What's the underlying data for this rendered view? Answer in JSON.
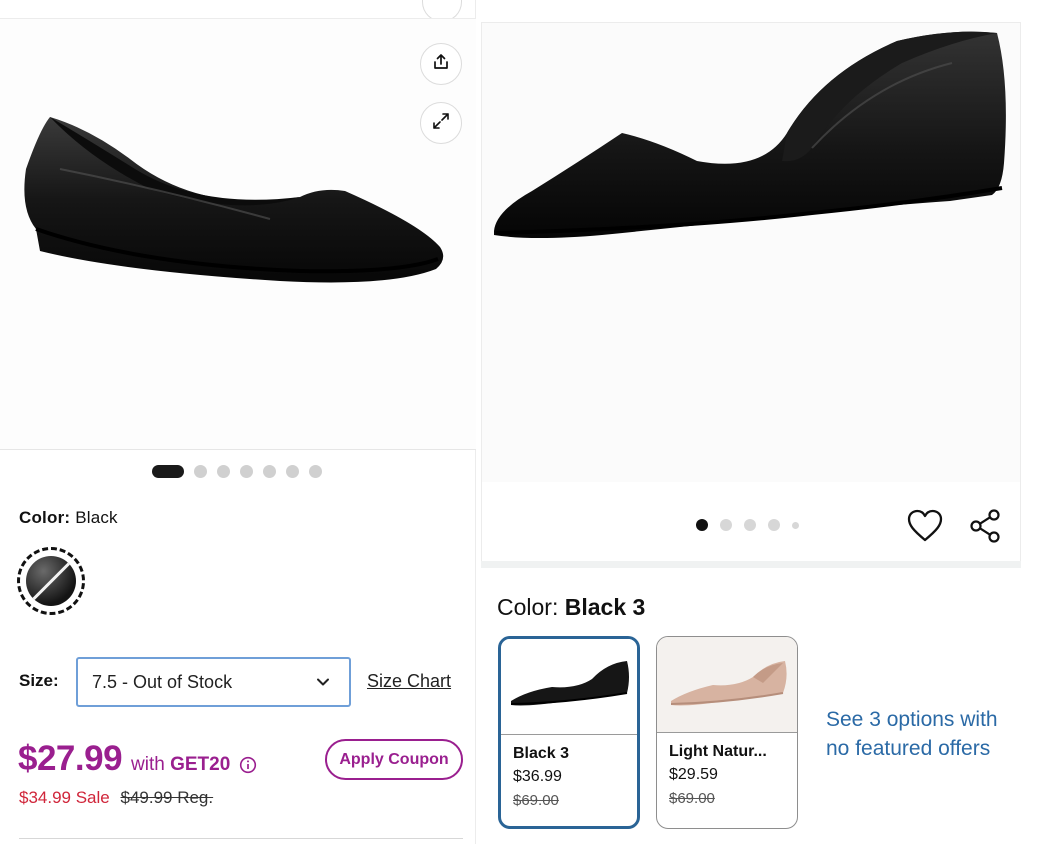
{
  "left": {
    "carousel": {
      "dot_count": 7,
      "active_index": 0
    },
    "color": {
      "label": "Color:",
      "value": "Black"
    },
    "size": {
      "label": "Size:",
      "selected": "7.5 - Out of Stock",
      "chart_link": "Size Chart"
    },
    "price": {
      "promo_price": "$27.99",
      "promo_with": "with",
      "promo_code": "GET20",
      "apply_coupon": "Apply Coupon",
      "sale_price": "$34.99 Sale",
      "reg_price": "$49.99 Reg."
    },
    "colors": {
      "brand": "#9a1f8f",
      "sale": "#d0253a",
      "select_border": "#6f9fd8"
    }
  },
  "right": {
    "carousel": {
      "dot_count": 5,
      "active_index": 0
    },
    "color": {
      "label": "Color:",
      "value": "Black 3"
    },
    "options": [
      {
        "name": "Black 3",
        "price": "$36.99",
        "was": "$69.00",
        "selected": true,
        "shade": "black"
      },
      {
        "name": "Light Natur...",
        "price": "$29.59",
        "was": "$69.00",
        "selected": false,
        "shade": "beige"
      }
    ],
    "see_options": "See 3 options with no featured offers",
    "colors": {
      "link": "#2b6aa6",
      "selected_border": "#2a6496"
    }
  },
  "icons": [
    "share-upload-icon",
    "expand-icon",
    "chevron-down-icon",
    "info-icon",
    "heart-icon",
    "share-icon"
  ]
}
